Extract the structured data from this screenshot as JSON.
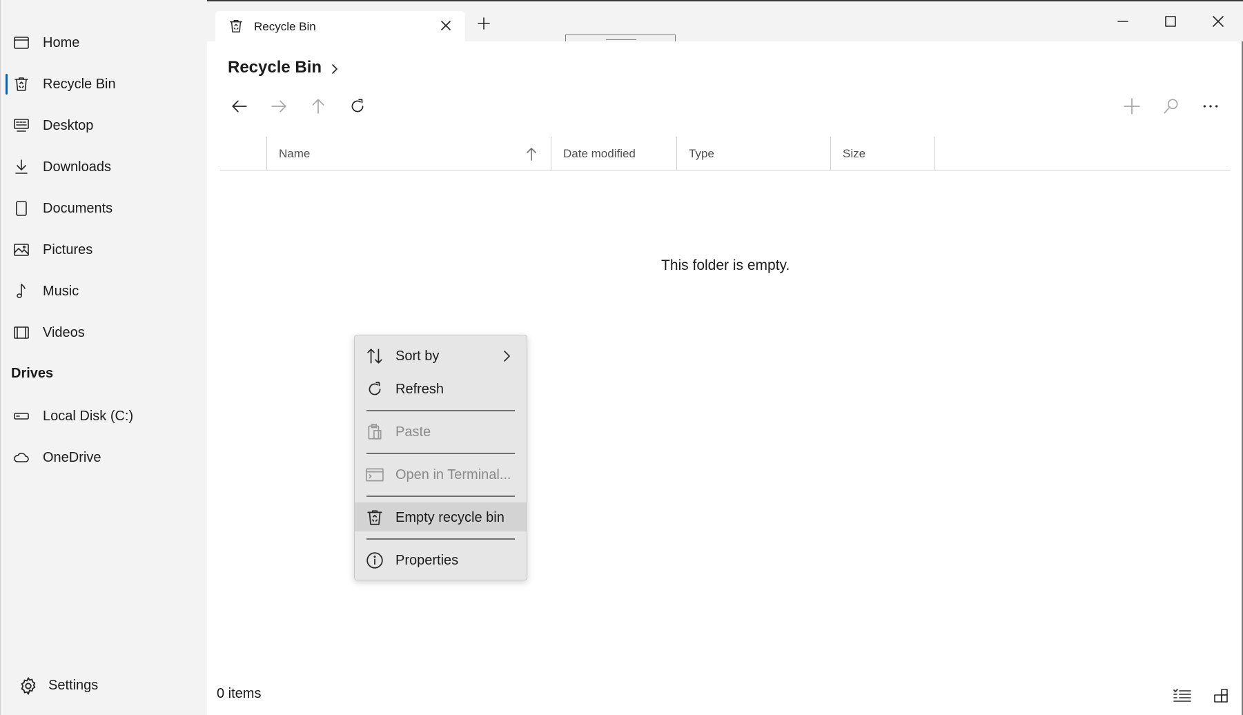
{
  "tab": {
    "title": "Recycle Bin"
  },
  "breadcrumb": {
    "items": [
      "Recycle Bin"
    ]
  },
  "sidebar": {
    "items": [
      {
        "label": "Home",
        "icon": "home-icon"
      },
      {
        "label": "Recycle Bin",
        "icon": "recycle-bin-icon",
        "active": true
      },
      {
        "label": "Desktop",
        "icon": "desktop-icon"
      },
      {
        "label": "Downloads",
        "icon": "download-icon"
      },
      {
        "label": "Documents",
        "icon": "document-icon"
      },
      {
        "label": "Pictures",
        "icon": "picture-icon"
      },
      {
        "label": "Music",
        "icon": "music-icon"
      },
      {
        "label": "Videos",
        "icon": "video-icon"
      }
    ],
    "drives_header": "Drives",
    "drives": [
      {
        "label": "Local Disk (C:)",
        "icon": "drive-icon"
      },
      {
        "label": "OneDrive",
        "icon": "cloud-icon"
      }
    ],
    "settings_label": "Settings"
  },
  "columns": [
    "Name",
    "Date modified",
    "Type",
    "Size"
  ],
  "sort": {
    "column": "Name",
    "direction": "ascending"
  },
  "empty_message": "This folder is empty.",
  "context_menu": {
    "items": [
      {
        "label": "Sort by",
        "icon": "sort-icon",
        "submenu": true
      },
      {
        "label": "Refresh",
        "icon": "refresh-icon"
      },
      {
        "label": "Paste",
        "icon": "paste-icon",
        "disabled": true
      },
      {
        "label": "Open in Terminal...",
        "icon": "terminal-icon",
        "disabled": true
      },
      {
        "label": "Empty recycle bin",
        "icon": "recycle-bin-icon",
        "highlighted": true
      },
      {
        "label": "Properties",
        "icon": "info-icon"
      }
    ]
  },
  "status": {
    "item_count": "0 items"
  },
  "colors": {
    "accent": "#0067c0",
    "sidebar_bg": "#f3f3f3",
    "menu_bg": "#e6e6e6",
    "menu_hover": "#d3d3d3"
  }
}
